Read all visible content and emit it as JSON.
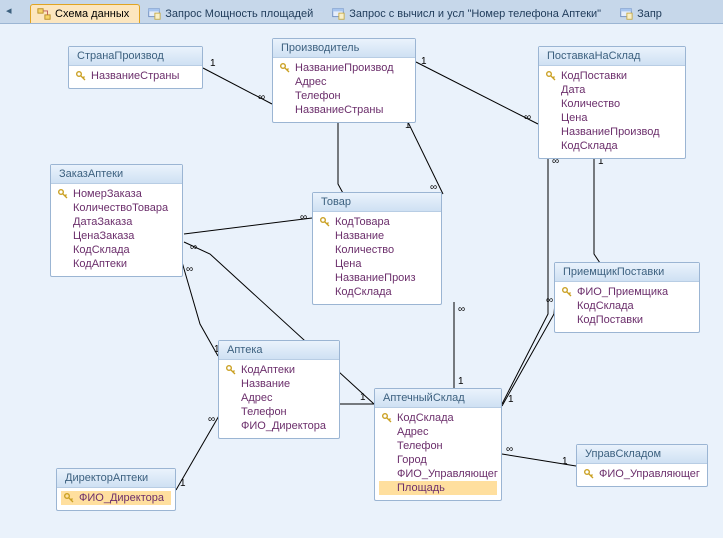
{
  "tabs": {
    "prev_indicator": "◂",
    "items": [
      {
        "label": "Схема данных",
        "icon": "relations-icon",
        "active": true
      },
      {
        "label": "Запрос Мощность площадей",
        "icon": "query-icon",
        "active": false
      },
      {
        "label": "Запрос с вычисл и усл \"Номер телефона Аптеки\"",
        "icon": "query-icon",
        "active": false
      },
      {
        "label": "Запр",
        "icon": "query-icon",
        "active": false
      }
    ]
  },
  "tables": {
    "strana": {
      "title": "СтранаПроизвод",
      "fields": [
        {
          "name": "НазваниеСтраны",
          "key": true
        }
      ]
    },
    "proizvoditel": {
      "title": "Производитель",
      "fields": [
        {
          "name": "НазваниеПроизвод",
          "key": true
        },
        {
          "name": "Адрес",
          "key": false
        },
        {
          "name": "Телефон",
          "key": false
        },
        {
          "name": "НазваниеСтраны",
          "key": false
        }
      ]
    },
    "postavka": {
      "title": "ПоставкаНаСклад",
      "fields": [
        {
          "name": "КодПоставки",
          "key": true
        },
        {
          "name": "Дата",
          "key": false
        },
        {
          "name": "Количество",
          "key": false
        },
        {
          "name": "Цена",
          "key": false
        },
        {
          "name": "НазваниеПроизвод",
          "key": false
        },
        {
          "name": "КодСклада",
          "key": false
        }
      ]
    },
    "zakaz": {
      "title": "ЗаказАптеки",
      "fields": [
        {
          "name": "НомерЗаказа",
          "key": true
        },
        {
          "name": "КоличествоТовара",
          "key": false
        },
        {
          "name": "ДатаЗаказа",
          "key": false
        },
        {
          "name": "ЦенаЗаказа",
          "key": false
        },
        {
          "name": "КодСклада",
          "key": false
        },
        {
          "name": "КодАптеки",
          "key": false
        }
      ]
    },
    "tovar": {
      "title": "Товар",
      "fields": [
        {
          "name": "КодТовара",
          "key": true
        },
        {
          "name": "Название",
          "key": false
        },
        {
          "name": "Количество",
          "key": false
        },
        {
          "name": "Цена",
          "key": false
        },
        {
          "name": "НазваниеПроиз",
          "key": false
        },
        {
          "name": "КодСклада",
          "key": false
        }
      ]
    },
    "priemshik": {
      "title": "ПриемщикПоставки",
      "fields": [
        {
          "name": "ФИО_Приемщика",
          "key": true
        },
        {
          "name": "КодСклада",
          "key": false
        },
        {
          "name": "КодПоставки",
          "key": false
        }
      ]
    },
    "apteka": {
      "title": "Аптека",
      "fields": [
        {
          "name": "КодАптеки",
          "key": true
        },
        {
          "name": "Название",
          "key": false
        },
        {
          "name": "Адрес",
          "key": false
        },
        {
          "name": "Телефон",
          "key": false
        },
        {
          "name": "ФИО_Директора",
          "key": false
        }
      ]
    },
    "direktor": {
      "title": "ДиректорАптеки",
      "fields": [
        {
          "name": "ФИО_Директора",
          "key": true,
          "selected": true
        }
      ]
    },
    "sklad": {
      "title": "АптечныйСклад",
      "fields": [
        {
          "name": "КодСклада",
          "key": true
        },
        {
          "name": "Адрес",
          "key": false
        },
        {
          "name": "Телефон",
          "key": false
        },
        {
          "name": "Город",
          "key": false
        },
        {
          "name": "ФИО_Управляющег",
          "key": false
        },
        {
          "name": "Площадь",
          "key": false,
          "selected": true
        }
      ]
    },
    "uprav": {
      "title": "УправСкладом",
      "fields": [
        {
          "name": "ФИО_Управляющег",
          "key": true
        }
      ]
    }
  },
  "relation_labels": {
    "one": "1",
    "many": "∞"
  }
}
